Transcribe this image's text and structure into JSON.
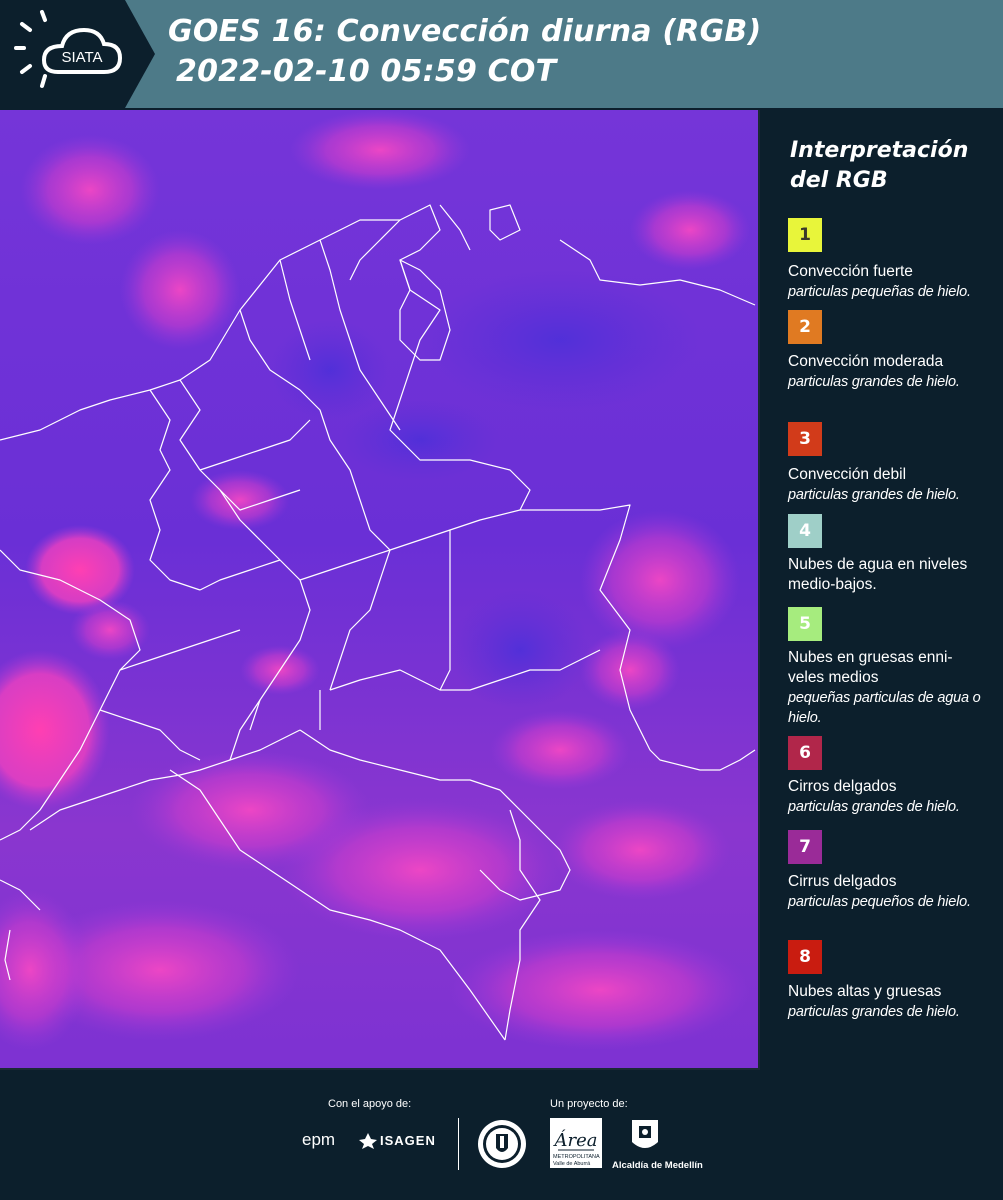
{
  "header": {
    "logo_text": "SIATA",
    "title_line1": "GOES 16: Convección diurna (RGB)",
    "title_line2": "2022-02-10 05:59 COT",
    "background_color": "#4d7a88"
  },
  "legend": {
    "title_line1": "Interpretación",
    "title_line2": "del RGB",
    "items": [
      {
        "number": "1",
        "color": "#e8f53a",
        "text_color": "#3a3a2a",
        "name": "Convección fuerte",
        "description": "particulas pequeñas de hielo."
      },
      {
        "number": "2",
        "color": "#e07a22",
        "text_color": "#ffffff",
        "name": "Convección moderada",
        "description": "particulas grandes de hielo."
      },
      {
        "number": "3",
        "color": "#d23b1a",
        "text_color": "#ffffff",
        "name": "Convección debil",
        "description": "particulas grandes de hielo."
      },
      {
        "number": "4",
        "color": "#9fcfc8",
        "text_color": "#ffffff",
        "name": "Nubes de agua en niveles medio-bajos.",
        "description": ""
      },
      {
        "number": "5",
        "color": "#a6ec7e",
        "text_color": "#ffffff",
        "name": "Nubes en gruesas enni-veles medios",
        "description": "pequeñas particulas de agua o hielo."
      },
      {
        "number": "6",
        "color": "#b1264a",
        "text_color": "#ffffff",
        "name": "Cirros delgados",
        "description": "particulas grandes de hielo."
      },
      {
        "number": "7",
        "color": "#9a2b98",
        "text_color": "#ffffff",
        "name": "Cirrus delgados",
        "description": "particulas pequeños de hielo."
      },
      {
        "number": "8",
        "color": "#c91c10",
        "text_color": "#ffffff",
        "name": "Nubes altas y gruesas",
        "description": "particulas grandes de hielo."
      }
    ]
  },
  "footer": {
    "support_label": "Con el apoyo de:",
    "project_label": "Un proyecto de:",
    "sponsors": [
      "epm",
      "ISAGEN"
    ],
    "area_logo_text": "Área",
    "area_caption": "METROPOLITANA Valle de Aburrá",
    "alcaldia_text": "Alcaldía de Medellín"
  },
  "map": {
    "base_color": "#6a2fd6",
    "cloud_color": "#e040c8",
    "border_color": "#ffffff"
  }
}
